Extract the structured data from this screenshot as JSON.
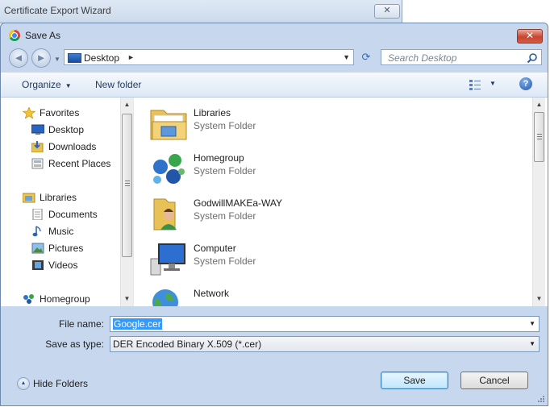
{
  "background_window": {
    "title": "Certificate Export Wizard",
    "close_glyph": "✕"
  },
  "dialog": {
    "title": "Save As",
    "close_glyph": "✕"
  },
  "nav": {
    "back_glyph": "◄",
    "forward_glyph": "►",
    "recent_glyph": "▼",
    "address": "Desktop",
    "crumb_arrow": "►",
    "dropdown_glyph": "▼",
    "refresh_glyph": "⟳",
    "search_placeholder": "Search Desktop"
  },
  "toolbar": {
    "organize": "Organize",
    "caret": "▼",
    "new_folder": "New folder",
    "help_glyph": "?"
  },
  "sidebar": {
    "items": [
      {
        "label": "Favorites",
        "icon": "star-icon"
      },
      {
        "label": "Desktop",
        "icon": "desktop-icon"
      },
      {
        "label": "Downloads",
        "icon": "downloads-icon"
      },
      {
        "label": "Recent Places",
        "icon": "recent-places-icon"
      },
      {
        "label": "Libraries",
        "icon": "libraries-icon"
      },
      {
        "label": "Documents",
        "icon": "documents-icon"
      },
      {
        "label": "Music",
        "icon": "music-icon"
      },
      {
        "label": "Pictures",
        "icon": "pictures-icon"
      },
      {
        "label": "Videos",
        "icon": "videos-icon"
      },
      {
        "label": "Homegroup",
        "icon": "homegroup-icon"
      }
    ]
  },
  "files": [
    {
      "name": "Libraries",
      "type": "System Folder",
      "icon": "libraries-folder-icon"
    },
    {
      "name": "Homegroup",
      "type": "System Folder",
      "icon": "homegroup-icon"
    },
    {
      "name": "GodwillMAKEa-WAY",
      "type": "System Folder",
      "icon": "user-folder-icon"
    },
    {
      "name": "Computer",
      "type": "System Folder",
      "icon": "computer-icon"
    },
    {
      "name": "Network",
      "type": "",
      "icon": "network-icon"
    }
  ],
  "form": {
    "file_name_label": "File name:",
    "file_name_value": "Google.cer",
    "save_type_label": "Save as type:",
    "save_type_value": "DER Encoded Binary X.509 (*.cer)",
    "dropdown_glyph": "▼"
  },
  "footer": {
    "hide_folders": "Hide Folders",
    "hide_glyph": "▲",
    "save": "Save",
    "cancel": "Cancel"
  },
  "scroll": {
    "up_glyph": "▲",
    "down_glyph": "▼"
  },
  "colors": {
    "selection": "#3399ff",
    "frame": "#c7d8ee",
    "close_red": "#c8452f"
  }
}
